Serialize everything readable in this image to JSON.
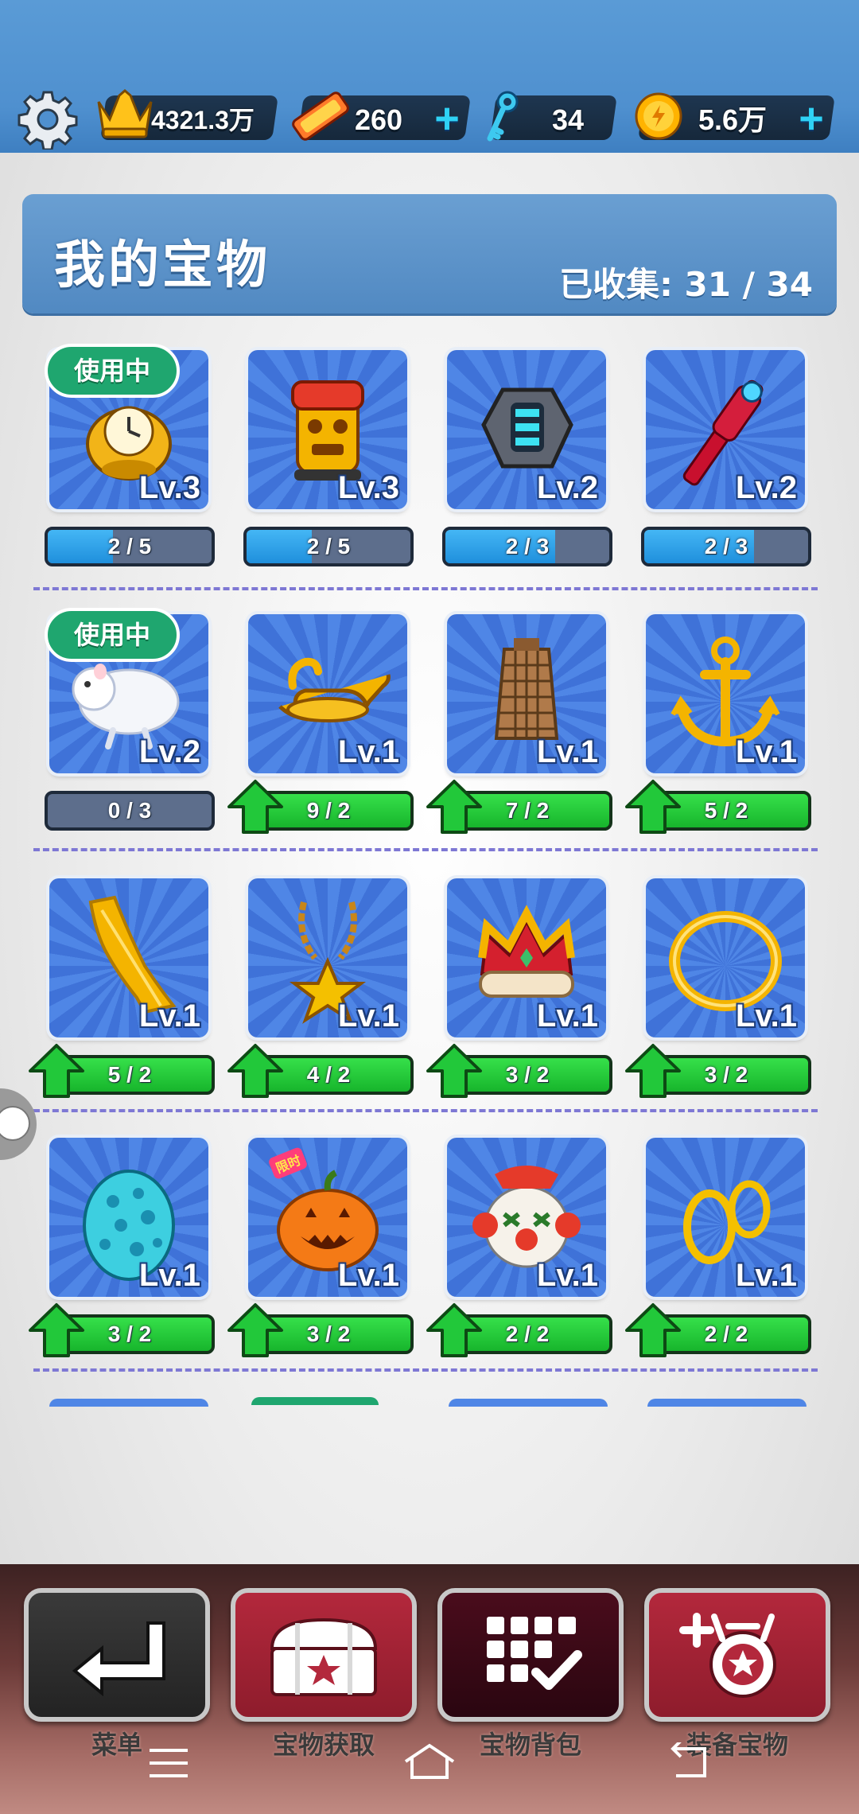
{
  "top_bar": {
    "crowns": "4321.3万",
    "tickets": "260",
    "keys": "34",
    "coins": "5.6万"
  },
  "header": {
    "title": "我的宝物",
    "collected": "已收集: 31 / 34"
  },
  "in_use_label": "使用中",
  "limited_label": "限时",
  "treasures": [
    {
      "icon": "alarm-clock-icon",
      "level": "Lv.3",
      "progress": "2/5",
      "progress_fraction": 0.4,
      "upgradable": false,
      "in_use": true
    },
    {
      "icon": "tiki-totem-icon",
      "level": "Lv.3",
      "progress": "2/5",
      "progress_fraction": 0.4,
      "upgradable": false,
      "in_use": false
    },
    {
      "icon": "smartwatch-icon",
      "level": "Lv.2",
      "progress": "2/3",
      "progress_fraction": 0.667,
      "upgradable": false,
      "in_use": false
    },
    {
      "icon": "magic-wand-icon",
      "level": "Lv.2",
      "progress": "2/3",
      "progress_fraction": 0.667,
      "upgradable": false,
      "in_use": false
    },
    {
      "icon": "hamster-icon",
      "level": "Lv.2",
      "progress": "0/3",
      "progress_fraction": 0,
      "upgradable": false,
      "in_use": true
    },
    {
      "icon": "magic-lamp-icon",
      "level": "Lv.1",
      "progress": "9/2",
      "progress_fraction": 1,
      "upgradable": true,
      "in_use": false
    },
    {
      "icon": "skyscraper-icon",
      "level": "Lv.1",
      "progress": "7/2",
      "progress_fraction": 1,
      "upgradable": true,
      "in_use": false
    },
    {
      "icon": "anchor-icon",
      "level": "Lv.1",
      "progress": "5/2",
      "progress_fraction": 1,
      "upgradable": true,
      "in_use": false
    },
    {
      "icon": "golden-feather-icon",
      "level": "Lv.1",
      "progress": "5/2",
      "progress_fraction": 1,
      "upgradable": true,
      "in_use": false
    },
    {
      "icon": "star-necklace-icon",
      "level": "Lv.1",
      "progress": "4/2",
      "progress_fraction": 1,
      "upgradable": true,
      "in_use": false
    },
    {
      "icon": "crown-icon",
      "level": "Lv.1",
      "progress": "3/2",
      "progress_fraction": 1,
      "upgradable": true,
      "in_use": false
    },
    {
      "icon": "golden-ring-icon",
      "level": "Lv.1",
      "progress": "3/2",
      "progress_fraction": 1,
      "upgradable": true,
      "in_use": false
    },
    {
      "icon": "dragon-egg-icon",
      "level": "Lv.1",
      "progress": "3/2",
      "progress_fraction": 1,
      "upgradable": true,
      "in_use": false
    },
    {
      "icon": "pumpkin-icon",
      "level": "Lv.1",
      "progress": "3/2",
      "progress_fraction": 1,
      "upgradable": true,
      "in_use": false,
      "limited": true
    },
    {
      "icon": "clown-mask-icon",
      "level": "Lv.1",
      "progress": "2/2",
      "progress_fraction": 1,
      "upgradable": true,
      "in_use": false
    },
    {
      "icon": "gold-hoops-icon",
      "level": "Lv.1",
      "progress": "2/2",
      "progress_fraction": 1,
      "upgradable": true,
      "in_use": false
    }
  ],
  "bottom_nav": {
    "menu": "菜单",
    "acquire": "宝物获取",
    "backpack": "宝物背包",
    "equip": "装备宝物"
  },
  "colors": {
    "top_bar": "#4f90cf",
    "card_blue": "#3f72d8",
    "progress_blue": "#1f8fdc",
    "upgrade_green": "#17b52c",
    "in_use_green": "#1fa66f",
    "btn_dark": "#2d2d2d",
    "btn_red": "#a42236",
    "btn_active": "#3a0a16"
  }
}
